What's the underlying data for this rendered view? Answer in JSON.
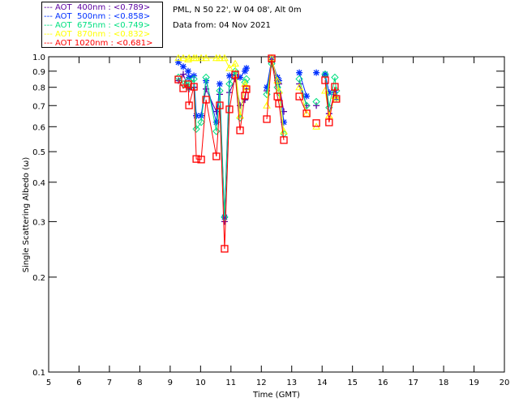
{
  "header": {
    "site": "PML, N 50 22', W 04 08', Alt 0m",
    "date": "Data from: 04 Nov 2021"
  },
  "chart_data": {
    "type": "line",
    "xlabel": "Time (GMT)",
    "ylabel": "Single Scattering Albedo (ω)",
    "xlim": [
      5,
      20
    ],
    "ylim": [
      0.1,
      1.0
    ],
    "yscale": "log",
    "xticks": [
      5,
      6,
      7,
      8,
      9,
      10,
      11,
      12,
      13,
      14,
      15,
      16,
      17,
      18,
      19,
      20
    ],
    "yticks": [
      0.1,
      0.2,
      0.3,
      0.4,
      0.5,
      0.6,
      0.7,
      0.8,
      0.9,
      1.0
    ],
    "ytick_labels": [
      "0.1",
      "0.2",
      "0.3",
      "0.4",
      "0.5",
      "0.6",
      "0.7",
      "0.8",
      "0.9",
      "1.0"
    ],
    "legend_position": "top-left",
    "x": [
      9.27,
      9.43,
      9.59,
      9.62,
      9.78,
      9.86,
      10.02,
      10.18,
      10.52,
      10.63,
      10.79,
      10.95,
      11.14,
      11.3,
      11.46,
      11.51,
      12.18,
      12.34,
      12.53,
      12.58,
      12.74,
      13.25,
      13.49,
      13.81,
      14.1,
      14.23,
      14.42,
      14.47
    ],
    "series": [
      {
        "name": "AOT  400nm : <0.789>",
        "color": "#5a00a0",
        "marker": "plus",
        "values": [
          0.84,
          0.88,
          0.8,
          0.79,
          0.8,
          0.65,
          0.65,
          0.79,
          0.67,
          0.76,
          0.3,
          0.77,
          0.85,
          0.7,
          0.73,
          0.79,
          0.78,
          0.96,
          0.84,
          0.82,
          0.67,
          0.82,
          0.7,
          0.7,
          0.87,
          0.66,
          0.77,
          0.74
        ]
      },
      {
        "name": "AOT  500nm : <0.858>",
        "color": "#0030ff",
        "marker": "asterisk",
        "values": [
          0.96,
          0.93,
          0.9,
          0.86,
          0.87,
          0.65,
          0.65,
          0.84,
          0.62,
          0.82,
          0.31,
          0.87,
          0.88,
          0.86,
          0.9,
          0.92,
          0.8,
          0.98,
          0.86,
          0.84,
          0.62,
          0.89,
          0.75,
          0.89,
          0.88,
          0.77,
          0.77,
          0.74
        ]
      },
      {
        "name": "AOT  675nm : <0.749>",
        "color": "#00e080",
        "marker": "diamond",
        "values": [
          0.86,
          0.82,
          0.84,
          0.8,
          0.85,
          0.59,
          0.62,
          0.86,
          0.58,
          0.78,
          0.31,
          0.82,
          0.9,
          0.64,
          0.83,
          0.85,
          0.76,
          0.95,
          0.8,
          0.77,
          0.57,
          0.85,
          0.7,
          0.72,
          0.88,
          0.69,
          0.86,
          0.78
        ]
      },
      {
        "name": "AOT  870nm : <0.832>",
        "color": "#ffff00",
        "marker": "triangle",
        "values": [
          0.99,
          0.99,
          0.98,
          0.99,
          0.99,
          0.99,
          0.99,
          0.99,
          0.99,
          0.99,
          0.99,
          0.92,
          0.95,
          0.65,
          0.82,
          0.8,
          0.7,
          0.99,
          0.84,
          0.78,
          0.58,
          0.8,
          0.66,
          0.6,
          0.78,
          0.65,
          0.75,
          0.74
        ]
      },
      {
        "name": "AOT 1020nm : <0.681>",
        "color": "#ff0000",
        "marker": "square",
        "values": [
          0.847,
          0.794,
          0.818,
          0.701,
          0.803,
          0.474,
          0.472,
          0.731,
          0.483,
          0.701,
          0.246,
          0.681,
          0.878,
          0.584,
          0.753,
          0.789,
          0.634,
          0.988,
          0.748,
          0.71,
          0.544,
          0.748,
          0.661,
          0.616,
          0.842,
          0.619,
          0.803,
          0.735
        ]
      }
    ]
  }
}
